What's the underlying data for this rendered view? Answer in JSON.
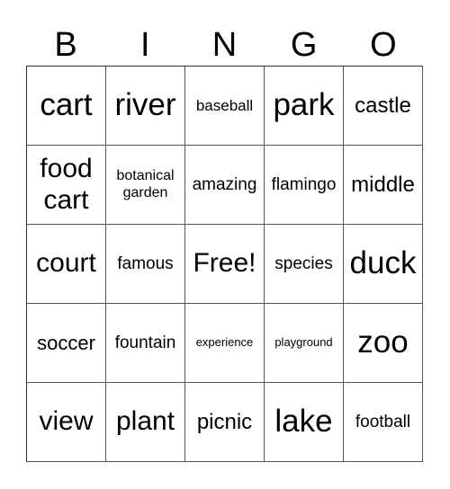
{
  "header": {
    "letters": [
      "B",
      "I",
      "N",
      "G",
      "O"
    ]
  },
  "board": {
    "cells": [
      "cart",
      "river",
      "baseball",
      "park",
      "castle",
      "food cart",
      "botanical garden",
      "amazing",
      "flamingo",
      "middle",
      "court",
      "famous",
      "Free!",
      "species",
      "duck",
      "soccer",
      "fountain",
      "experience",
      "playground",
      "zoo",
      "view",
      "plant",
      "picnic",
      "lake",
      "football"
    ],
    "free_space": "Free!"
  }
}
